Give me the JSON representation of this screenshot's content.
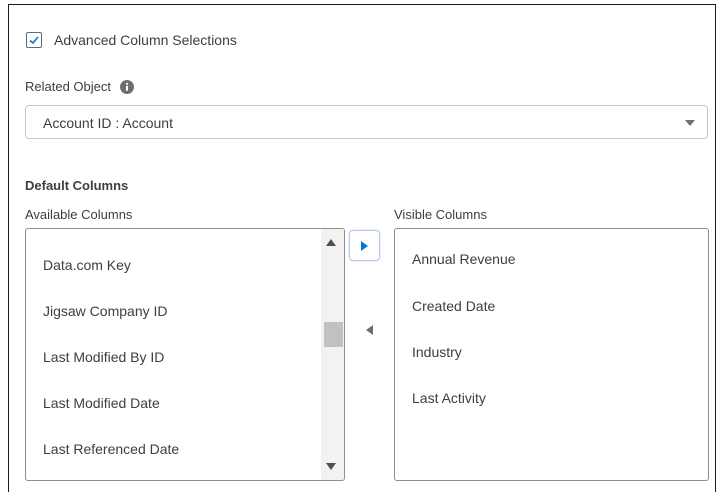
{
  "advanced": {
    "label": "Advanced Column Selections",
    "checked": true
  },
  "related_object": {
    "label": "Related Object",
    "value": "Account ID : Account"
  },
  "default_columns": {
    "title": "Default Columns",
    "available_label": "Available Columns",
    "visible_label": "Visible Columns",
    "available_items": [
      "Data.com Key",
      "Jigsaw Company ID",
      "Last Modified By ID",
      "Last Modified Date",
      "Last Referenced Date"
    ],
    "visible_items": [
      "Annual Revenue",
      "Created Date",
      "Industry",
      "Last Activity"
    ]
  },
  "colors": {
    "accent": "#0176d3",
    "border": "#c9c7c5",
    "text": "#3e3e3c"
  },
  "icons": {
    "checkbox": "check-icon",
    "info": "info-icon",
    "select": "chevron-down-icon",
    "move_right": "right-arrow-icon",
    "move_left": "left-arrow-icon"
  }
}
